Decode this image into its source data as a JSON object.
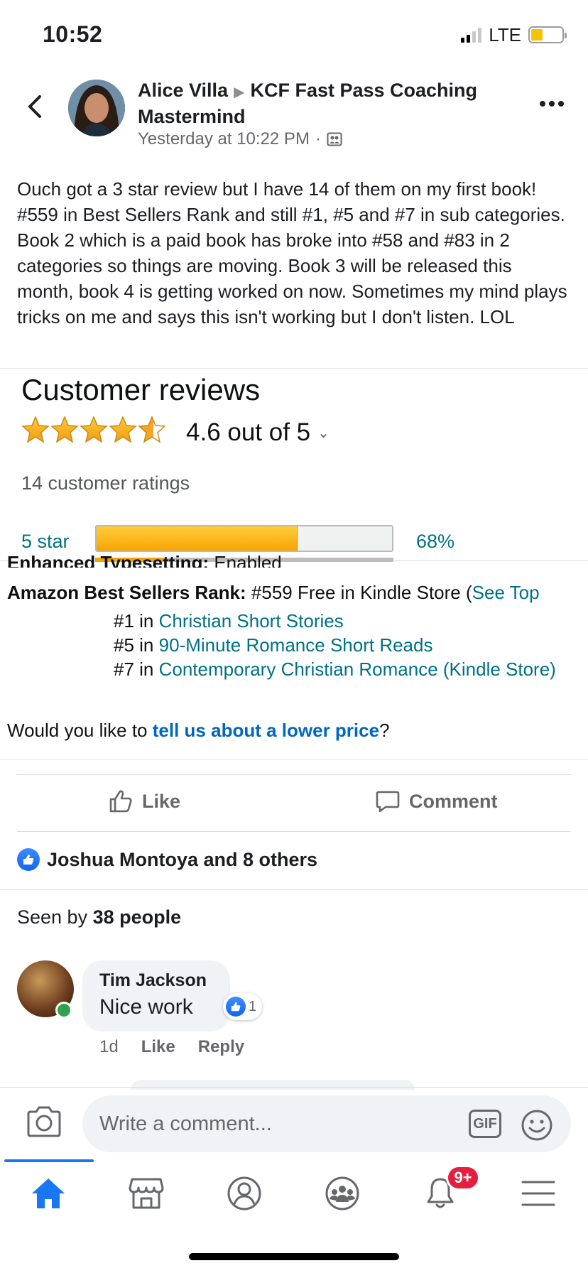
{
  "status": {
    "time": "10:52",
    "network": "LTE"
  },
  "post": {
    "author": "Alice Villa",
    "group": "KCF Fast Pass Coaching Mastermind",
    "timestamp": "Yesterday at 10:22 PM",
    "dot": "·",
    "body": "Ouch got a 3 star review but I have 14 of them on my first book! #559 in Best Sellers Rank and still #1, #5 and #7 in sub categories.  Book 2 which is a paid book has broke into #58 and #83 in 2 categories so things are moving. Book 3 will be released this month, book 4 is getting worked on now. Sometimes my mind plays tricks on me and says this isn't working but I don't listen. LOL"
  },
  "embed": {
    "title": "Customer reviews",
    "rating": 4.6,
    "rating_text": "4.6 out of 5",
    "ratings_count": "14 customer ratings",
    "bar_label": "5 star",
    "bar_fraction": 0.68,
    "bar_pct_text": "68%",
    "enhanced_label": "Enhanced Typesetting:",
    "enhanced_value": "Enabled",
    "rank_label": "Amazon Best Sellers Rank:",
    "rank_value": "#559 Free in Kindle Store (",
    "rank_link": "See Top",
    "sub_ranks": [
      {
        "rank": "#1 in ",
        "category": "Christian Short Stories"
      },
      {
        "rank": "#5 in ",
        "category": "90-Minute Romance Short Reads"
      },
      {
        "rank": "#7 in ",
        "category": "Contemporary Christian Romance (Kindle Store)"
      }
    ],
    "price_prefix": "Would you like to ",
    "price_link": "tell us about a lower price",
    "price_suffix": "?"
  },
  "actions": {
    "like": "Like",
    "comment": "Comment"
  },
  "reactions": {
    "text": "Joshua Montoya and 8 others"
  },
  "seen": {
    "prefix": "Seen by ",
    "count": "38 people"
  },
  "comment": {
    "name": "Tim Jackson",
    "text": "Nice work",
    "reaction_count": "1",
    "age": "1d",
    "like": "Like",
    "reply": "Reply"
  },
  "composer": {
    "placeholder": "Write a comment...",
    "gif": "GIF"
  },
  "tabbar": {
    "notification_badge": "9+"
  },
  "colors": {
    "facebook_blue": "#1877f2",
    "amazon_link": "#007185",
    "amazon_star": "#f7a400",
    "badge_red": "#e41e3f"
  }
}
